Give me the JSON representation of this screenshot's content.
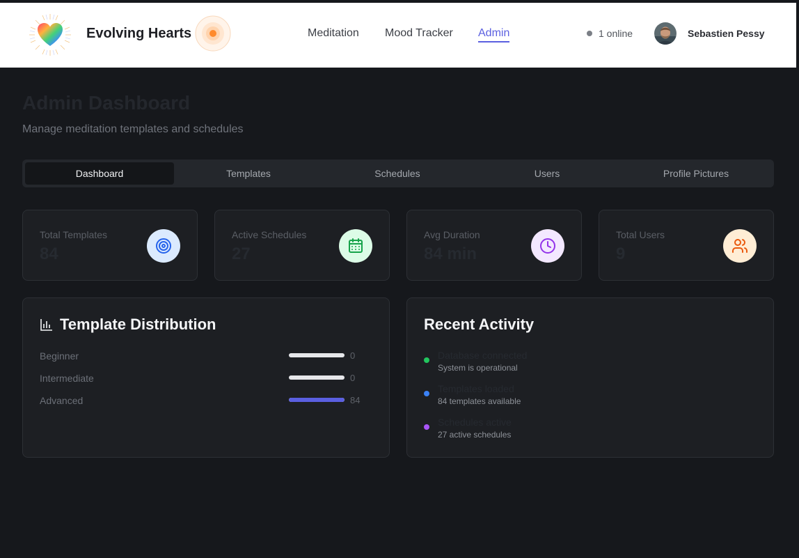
{
  "header": {
    "brand": "Evolving Hearts",
    "nav": [
      {
        "label": "Meditation",
        "active": false
      },
      {
        "label": "Mood Tracker",
        "active": false
      },
      {
        "label": "Admin",
        "active": true
      }
    ],
    "online_status": "1 online",
    "user_name": "Sebastien Pessy"
  },
  "page": {
    "title": "Admin Dashboard",
    "subtitle": "Manage meditation templates and schedules"
  },
  "tabs": [
    {
      "label": "Dashboard",
      "active": true
    },
    {
      "label": "Templates",
      "active": false
    },
    {
      "label": "Schedules",
      "active": false
    },
    {
      "label": "Users",
      "active": false
    },
    {
      "label": "Profile Pictures",
      "active": false
    }
  ],
  "stats": [
    {
      "label": "Total Templates",
      "value": "84",
      "icon": "target-icon",
      "icon_bg": "#dbeafe",
      "icon_color": "#2563eb"
    },
    {
      "label": "Active Schedules",
      "value": "27",
      "icon": "calendar-icon",
      "icon_bg": "#dcfce7",
      "icon_color": "#16a34a"
    },
    {
      "label": "Avg Duration",
      "value": "84 min",
      "icon": "clock-icon",
      "icon_bg": "#f3e8ff",
      "icon_color": "#9333ea"
    },
    {
      "label": "Total Users",
      "value": "9",
      "icon": "users-icon",
      "icon_bg": "#ffedd5",
      "icon_color": "#ea580c"
    }
  ],
  "distribution": {
    "title": "Template Distribution",
    "rows": [
      {
        "label": "Beginner",
        "count": "0",
        "fraction": 0,
        "color": "#5a5fe0"
      },
      {
        "label": "Intermediate",
        "count": "0",
        "fraction": 0,
        "color": "#5a5fe0"
      },
      {
        "label": "Advanced",
        "count": "84",
        "fraction": 1,
        "color": "#5a5fe0"
      }
    ]
  },
  "activity": {
    "title": "Recent Activity",
    "items": [
      {
        "title": "Database connected",
        "subtitle": "System is operational",
        "color": "#22c55e"
      },
      {
        "title": "Templates loaded",
        "subtitle": "84 templates available",
        "color": "#3b82f6"
      },
      {
        "title": "Schedules active",
        "subtitle": "27 active schedules",
        "color": "#a855f7"
      }
    ]
  }
}
